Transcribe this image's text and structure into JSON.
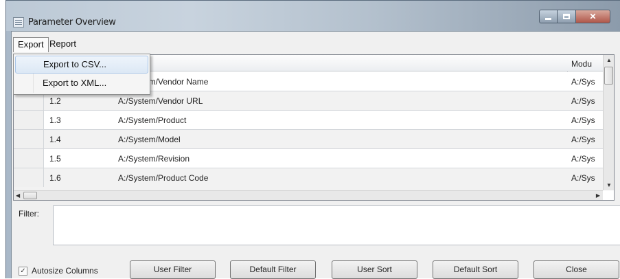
{
  "window": {
    "title": "Parameter Overview"
  },
  "menu": {
    "export": "Export",
    "report": "Report"
  },
  "export_menu": {
    "csv": "Export to CSV...",
    "xml": "Export to XML..."
  },
  "grid": {
    "columns": {
      "module": "Modu"
    },
    "rows": [
      {
        "id": "",
        "name": "A:/System/Vendor Name",
        "module": "A:/Sys"
      },
      {
        "id": "1.2",
        "name": "A:/System/Vendor URL",
        "module": "A:/Sys"
      },
      {
        "id": "1.3",
        "name": "A:/System/Product",
        "module": "A:/Sys"
      },
      {
        "id": "1.4",
        "name": "A:/System/Model",
        "module": "A:/Sys"
      },
      {
        "id": "1.5",
        "name": "A:/System/Revision",
        "module": "A:/Sys"
      },
      {
        "id": "1.6",
        "name": "A:/System/Product Code",
        "module": "A:/Sys"
      }
    ]
  },
  "filter": {
    "label": "Filter:",
    "value": ""
  },
  "controls": {
    "autosize_label": "Autosize Columns",
    "autosize_checked": true,
    "user_filter": "User Filter",
    "default_filter": "Default Filter",
    "user_sort": "User Sort",
    "default_sort": "Default Sort",
    "close": "Close"
  },
  "icons": {
    "app": "window-app-icon",
    "minimize": "minimize-icon",
    "maximize": "maximize-icon",
    "close": "close-icon",
    "check": "checkmark-icon"
  },
  "colors": {
    "title_bar": "#bcc9d6",
    "client_bg": "#f0f0f0",
    "menu_highlight": "#dce8f5",
    "close_button": "#b0574a"
  }
}
